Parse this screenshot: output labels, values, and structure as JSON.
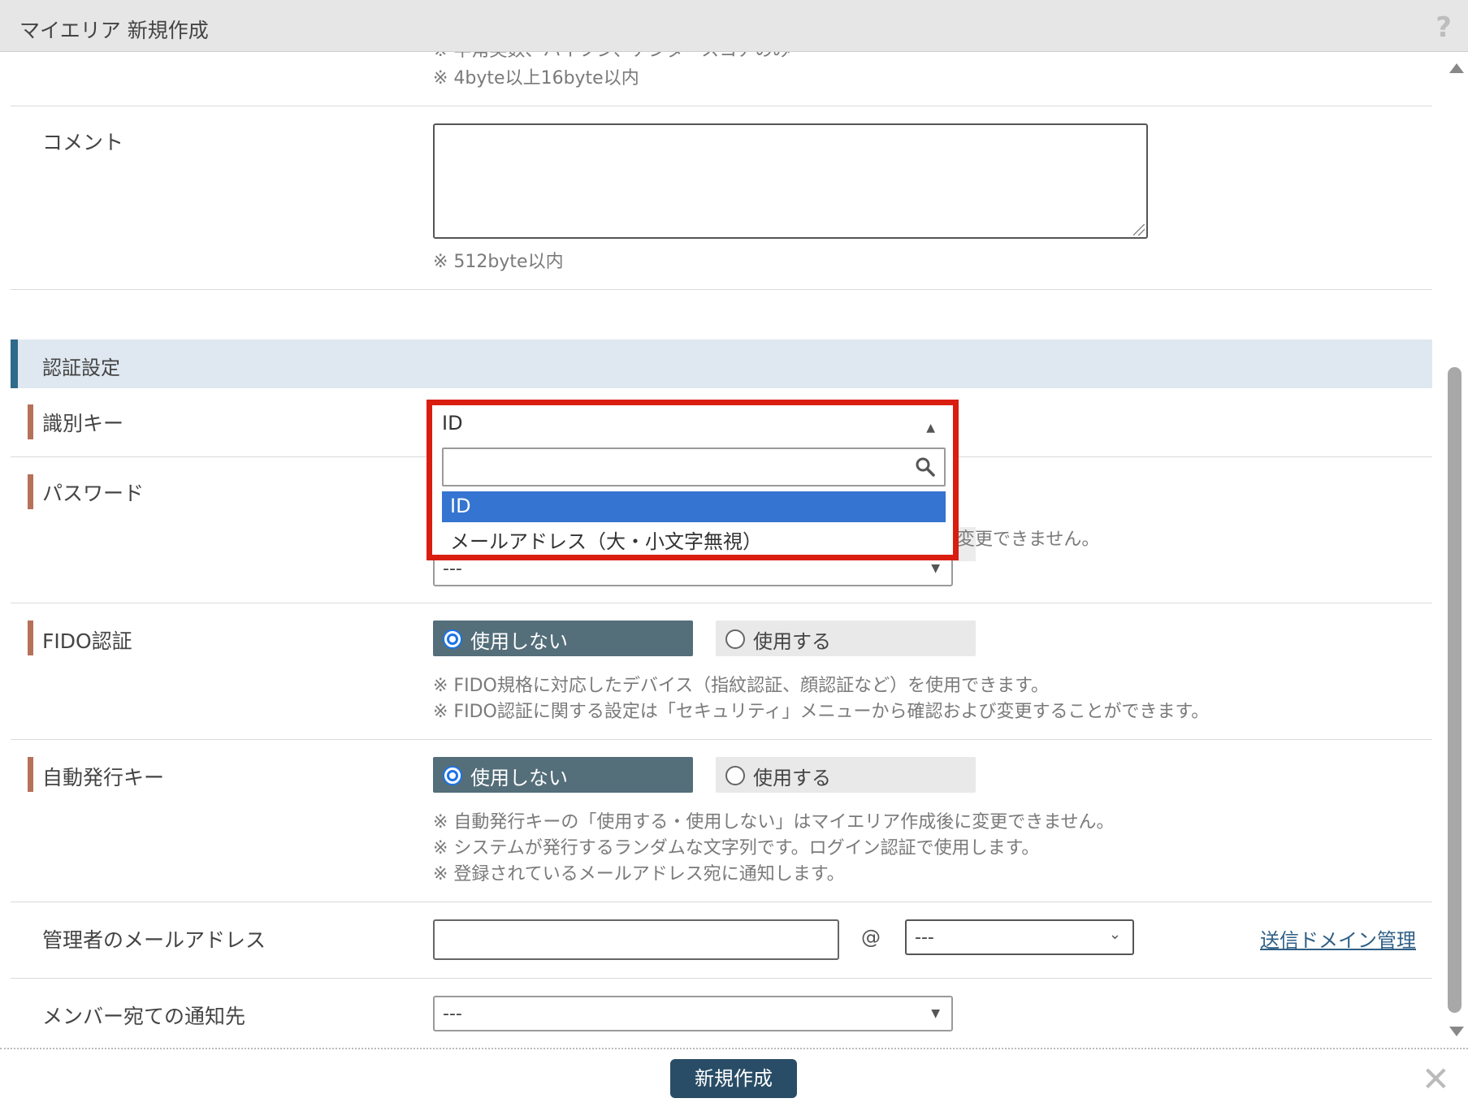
{
  "dialog": {
    "title": "マイエリア 新規作成",
    "help_icon": "?",
    "close_icon": "✕"
  },
  "top_notes": {
    "partial_line": "※ 半角英数、ハイフン、アンダースコアのみ",
    "byte_limit": "※ 4byte以上16byte以内"
  },
  "comment": {
    "label": "コメント",
    "value": "",
    "note": "※ 512byte以内"
  },
  "auth_section": {
    "title": "認証設定"
  },
  "identity_key": {
    "label": "識別キー",
    "selected": "ID",
    "search_value": "",
    "options": [
      "ID",
      "メールアドレス（大・小文字無視）"
    ]
  },
  "password": {
    "label": "パスワード",
    "note_partial": "変更できません。",
    "select_value": "---"
  },
  "fido": {
    "label": "FIDO認証",
    "option_off": "使用しない",
    "option_on": "使用する",
    "selected": "使用しない",
    "note1": "※ FIDO規格に対応したデバイス（指紋認証、顔認証など）を使用できます。",
    "note2": "※ FIDO認証に関する設定は「セキュリティ」メニューから確認および変更することができます。"
  },
  "auto_key": {
    "label": "自動発行キー",
    "option_off": "使用しない",
    "option_on": "使用する",
    "selected": "使用しない",
    "note1": "※ 自動発行キーの「使用する・使用しない」はマイエリア作成後に変更できません。",
    "note2": "※ システムが発行するランダムな文字列です。ログイン認証で使用します。",
    "note3": "※ 登録されているメールアドレス宛に通知します。"
  },
  "admin_email": {
    "label": "管理者のメールアドレス",
    "local_value": "",
    "at": "@",
    "domain_value": "---",
    "link": "送信ドメイン管理"
  },
  "member_notify": {
    "label": "メンバー宛ての通知先",
    "value": "---"
  },
  "footer": {
    "create_button": "新規作成"
  },
  "colors": {
    "accent_dark": "#294d66",
    "radio_selected_bg": "#546e7a",
    "required_marker": "#b5715a",
    "highlight_border": "#d91e0f",
    "option_selected": "#3574d0"
  }
}
